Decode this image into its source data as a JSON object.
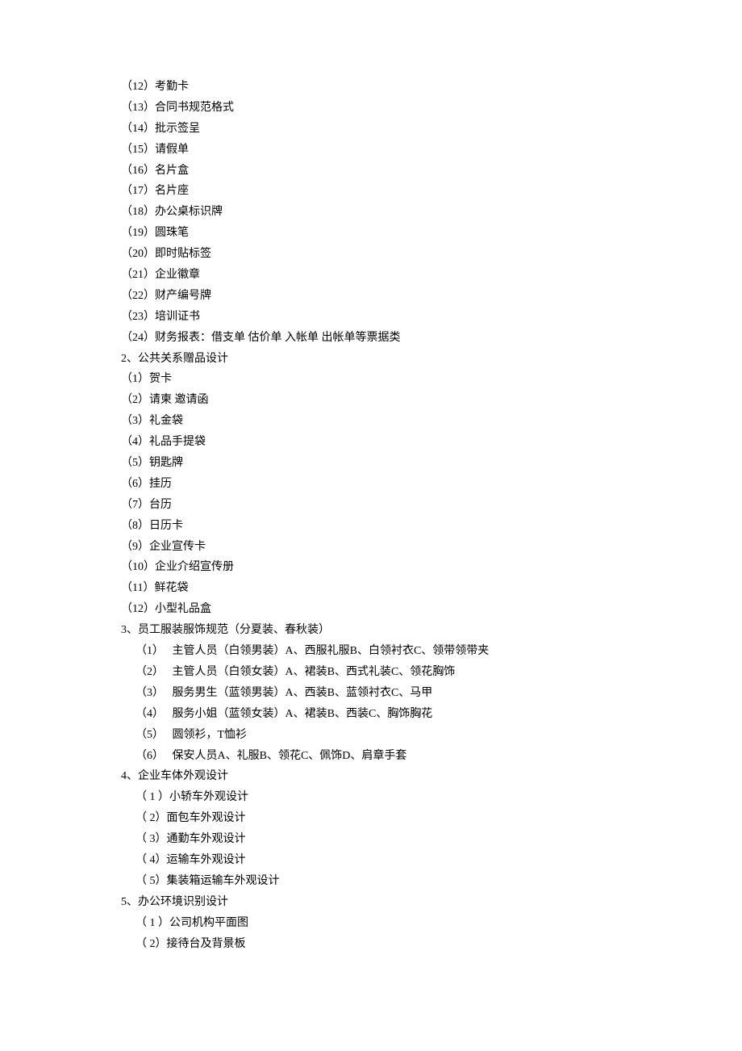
{
  "section1_cont": [
    "（12）考勤卡",
    "（13）合同书规范格式",
    "（14）批示签呈",
    "（15）请假单",
    "（16）名片盒",
    "（17）名片座",
    "（18）办公桌标识牌",
    "（19）圆珠笔",
    "（20）即时贴标签",
    "（21）企业徽章",
    "（22）财产编号牌",
    "（23）培训证书",
    "（24）财务报表：借支单 估价单 入帐单 出帐单等票据类"
  ],
  "section2": {
    "title": "2、公共关系赠品设计",
    "items": [
      "（1）贺卡",
      "（2）请柬 邀请函",
      "（3）礼金袋",
      "（4）礼品手提袋",
      "（5）钥匙牌",
      "（6）挂历",
      "（7）台历",
      "（8）日历卡",
      "（9）企业宣传卡",
      "（10）企业介绍宣传册",
      "（11）鲜花袋",
      "（12）小型礼品盒"
    ]
  },
  "section3": {
    "title": "3、员工服装服饰规范（分夏装、春秋装）",
    "items": [
      "（1）　 主管人员（白领男装）A、西服礼服B、白领衬衣C、领带领带夹",
      "（2）　 主管人员（白领女装）A、裙装B、西式礼装C、领花胸饰",
      "（3）　 服务男生（蓝领男装）A、西装B、蓝领衬衣C、马甲",
      "（4）　 服务小姐（蓝领女装）A、裙装B、西装C、胸饰胸花",
      "（5）　 圆领衫，T恤衫",
      "（6）　 保安人员A、礼服B、领花C、佩饰D、肩章手套"
    ]
  },
  "section4": {
    "title": "4、企业车体外观设计",
    "items": [
      "（ 1 ）小轿车外观设计",
      "（ 2）面包车外观设计",
      "（ 3）通勤车外观设计",
      "（ 4）运输车外观设计",
      "（ 5）集装箱运输车外观设计"
    ]
  },
  "section5": {
    "title": "5、办公环境识别设计",
    "items": [
      "（ 1 ）公司机构平面图",
      "（ 2）接待台及背景板"
    ]
  }
}
